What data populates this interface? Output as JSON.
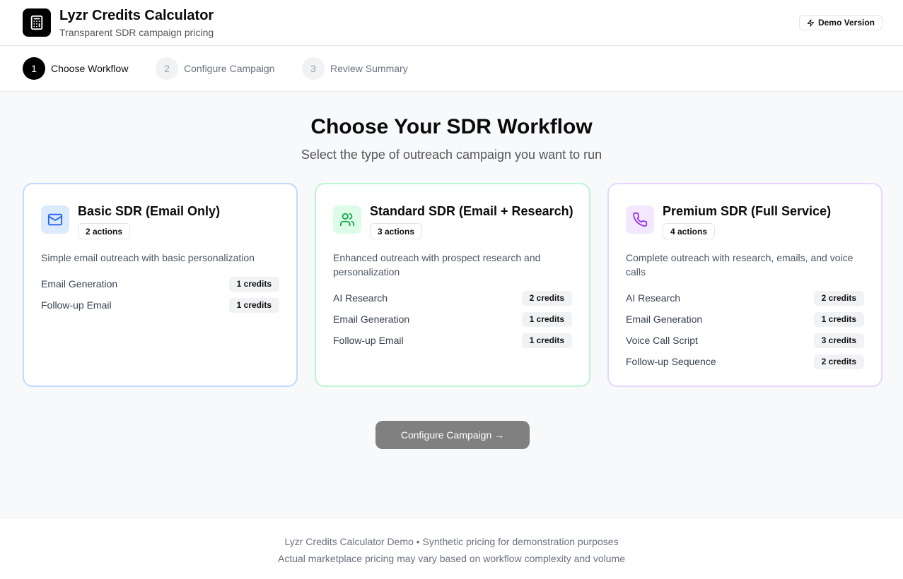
{
  "header": {
    "title": "Lyzr Credits Calculator",
    "subtitle": "Transparent SDR campaign pricing",
    "logo_icon": "calculator-icon",
    "demo_badge": "Demo Version",
    "demo_icon": "zap-icon"
  },
  "stepper": {
    "steps": [
      {
        "number": "1",
        "label": "Choose Workflow",
        "active": true
      },
      {
        "number": "2",
        "label": "Configure Campaign",
        "active": false
      },
      {
        "number": "3",
        "label": "Review Summary",
        "active": false
      }
    ]
  },
  "main": {
    "title": "Choose Your SDR Workflow",
    "subtitle": "Select the type of outreach campaign you want to run"
  },
  "workflows": [
    {
      "title": "Basic SDR (Email Only)",
      "actions_badge": "2 actions",
      "description": "Simple email outreach with basic personalization",
      "icon": "mail-icon",
      "accent": "#2563eb",
      "actions": [
        {
          "name": "Email Generation",
          "credits": "1 credits"
        },
        {
          "name": "Follow-up Email",
          "credits": "1 credits"
        }
      ]
    },
    {
      "title": "Standard SDR (Email + Research)",
      "actions_badge": "3 actions",
      "description": "Enhanced outreach with prospect research and personalization",
      "icon": "users-icon",
      "accent": "#16a34a",
      "actions": [
        {
          "name": "AI Research",
          "credits": "2 credits"
        },
        {
          "name": "Email Generation",
          "credits": "1 credits"
        },
        {
          "name": "Follow-up Email",
          "credits": "1 credits"
        }
      ]
    },
    {
      "title": "Premium SDR (Full Service)",
      "actions_badge": "4 actions",
      "description": "Complete outreach with research, emails, and voice calls",
      "icon": "phone-icon",
      "accent": "#9333ea",
      "actions": [
        {
          "name": "AI Research",
          "credits": "2 credits"
        },
        {
          "name": "Email Generation",
          "credits": "1 credits"
        },
        {
          "name": "Voice Call Script",
          "credits": "3 credits"
        },
        {
          "name": "Follow-up Sequence",
          "credits": "2 credits"
        }
      ]
    }
  ],
  "cta": {
    "label": "Configure Campaign →"
  },
  "footer": {
    "line1": "Lyzr Credits Calculator Demo • Synthetic pricing for demonstration purposes",
    "line2": "Actual marketplace pricing may vary based on workflow complexity and volume"
  }
}
